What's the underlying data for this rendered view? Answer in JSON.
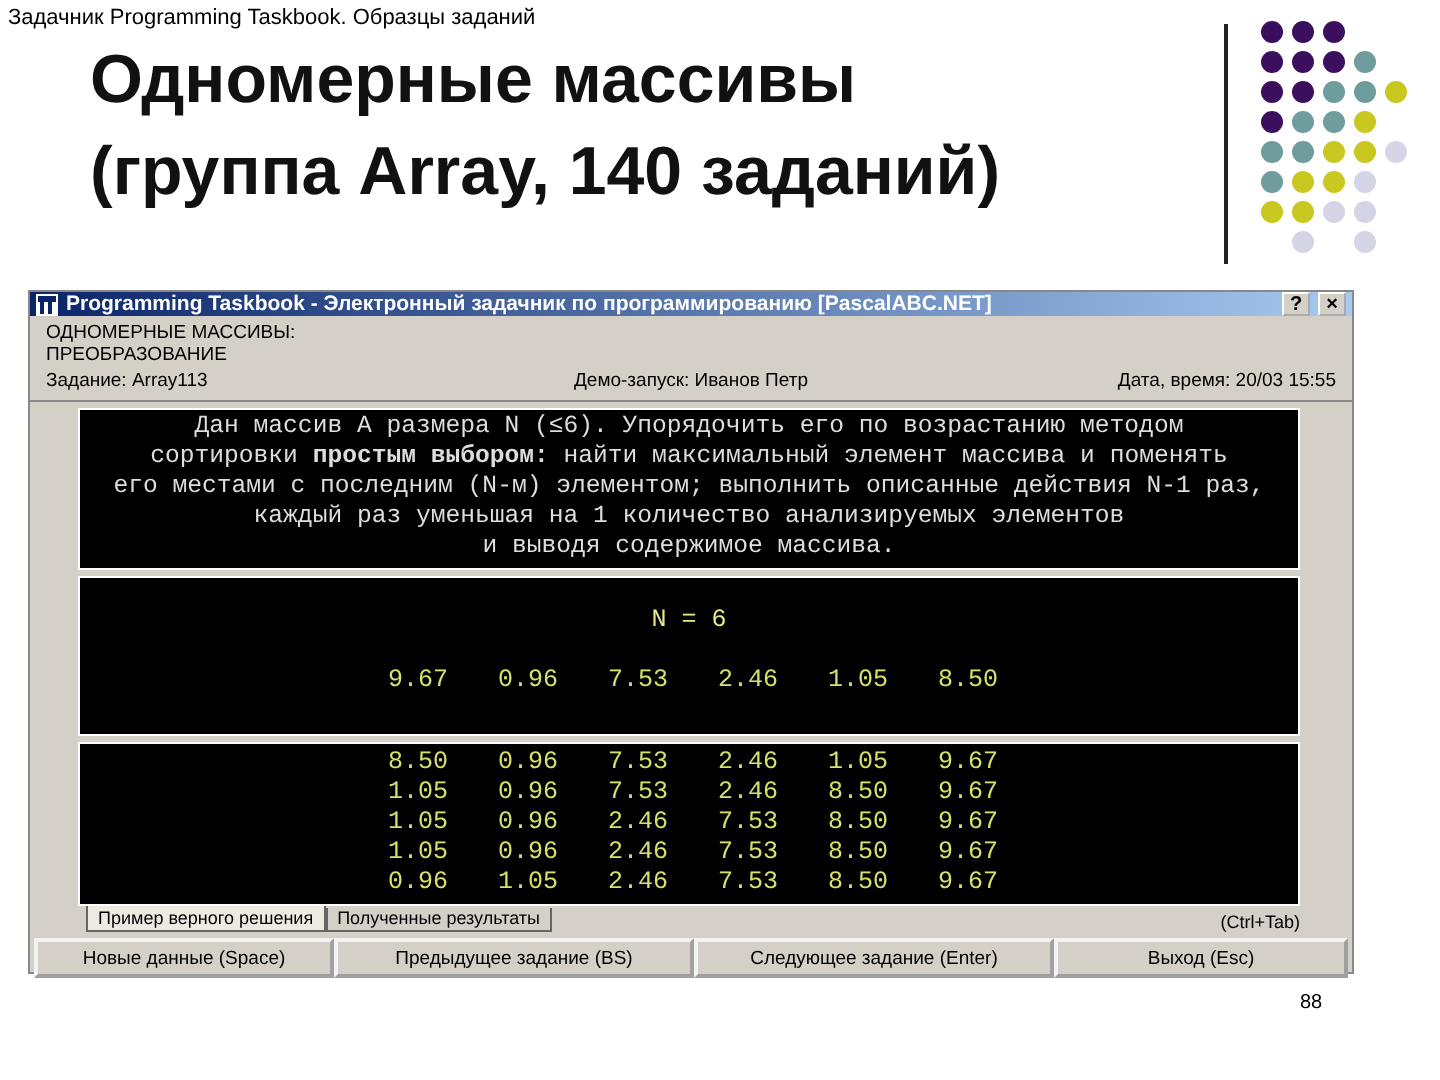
{
  "slide_header": "Задачник Programming Taskbook. Образцы заданий",
  "title_lines": [
    "Одномерные массивы",
    "(группа Array, 140 заданий)"
  ],
  "window": {
    "title": "Programming Taskbook - Электронный задачник по программированию [PascalABC.NET]",
    "help": "?",
    "close": "×"
  },
  "task_header": {
    "group": "ОДНОМЕРНЫЕ МАССИВЫ: ПРЕОБРАЗОВАНИЕ",
    "task": "Задание: Array113",
    "mode": "Демо-запуск: Иванов Петр",
    "date": "Дата, время: 20/03 15:55"
  },
  "task_text": [
    "Дан массив A размера N (≤6). Упорядочить его по возрастанию методом",
    "сортировки **простым выбором:** найти максимальный элемент массива и поменять",
    "его местами с последним (N-м) элементом; выполнить описанные действия N-1 раз,",
    "каждый раз уменьшая на 1 количество анализируемых элементов",
    "и выводя содержимое массива."
  ],
  "input": {
    "n_label": "N = 6",
    "values": [
      "9.67",
      "0.96",
      "7.53",
      "2.46",
      "1.05",
      "8.50"
    ]
  },
  "output_rows": [
    [
      "8.50",
      "0.96",
      "7.53",
      "2.46",
      "1.05",
      "9.67"
    ],
    [
      "1.05",
      "0.96",
      "7.53",
      "2.46",
      "8.50",
      "9.67"
    ],
    [
      "1.05",
      "0.96",
      "2.46",
      "7.53",
      "8.50",
      "9.67"
    ],
    [
      "1.05",
      "0.96",
      "2.46",
      "7.53",
      "8.50",
      "9.67"
    ],
    [
      "0.96",
      "1.05",
      "2.46",
      "7.53",
      "8.50",
      "9.67"
    ]
  ],
  "tabs": [
    {
      "label": "Пример верного решения",
      "selected": true
    },
    {
      "label": "Полученные результаты",
      "selected": false
    }
  ],
  "tab_hint": "(Ctrl+Tab)",
  "buttons": [
    "Новые данные (Space)",
    "Предыдущее задание (BS)",
    "Следующее задание (Enter)",
    "Выход (Esc)"
  ],
  "page_number": "88"
}
